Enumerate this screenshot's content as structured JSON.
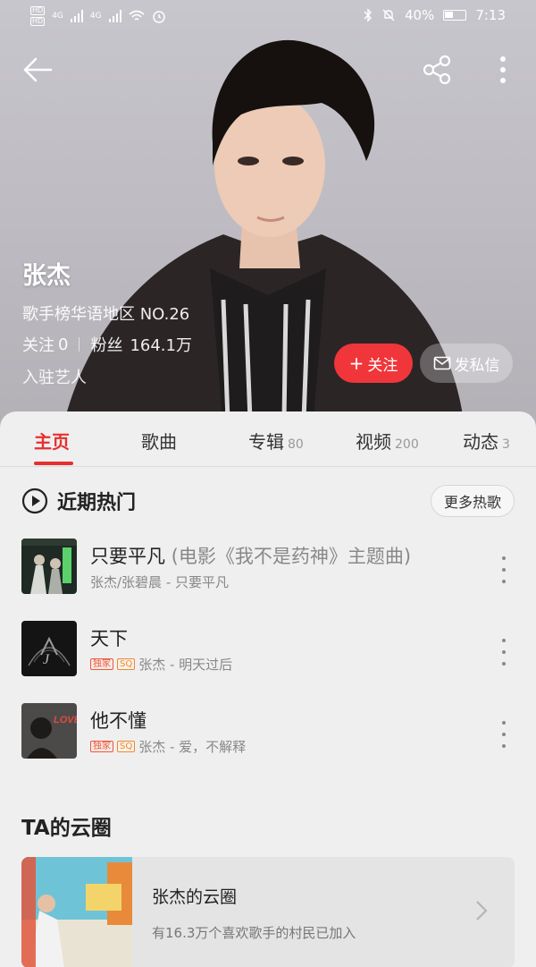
{
  "status_bar": {
    "hd1": "HD",
    "hd2": "HD",
    "net1": "4G",
    "net2": "4G",
    "battery": "40%",
    "time": "7:13"
  },
  "toolbar": {
    "back_icon": "back-arrow-icon",
    "share_icon": "share-icon",
    "more_icon": "more-vertical-icon"
  },
  "artist": {
    "name": "张杰",
    "rank": "歌手榜华语地区 NO.26",
    "following_label": "关注",
    "following_count": "0",
    "fans_label": "粉丝",
    "fans_count": "164.1万",
    "joined": "入驻艺人"
  },
  "actions": {
    "follow": "关注",
    "message": "发私信"
  },
  "tabs": [
    {
      "label": "主页",
      "count": ""
    },
    {
      "label": "歌曲",
      "count": ""
    },
    {
      "label": "专辑",
      "count": "80"
    },
    {
      "label": "视频",
      "count": "200"
    },
    {
      "label": "动态",
      "count": "3"
    }
  ],
  "hot_section": {
    "title": "近期热门",
    "more": "更多热歌"
  },
  "songs": [
    {
      "title": "只要平凡",
      "subtitle": " (电影《我不是药神》主题曲)",
      "exclusive": "",
      "sq": "",
      "meta": "张杰/张碧晨 - 只要平凡"
    },
    {
      "title": "天下",
      "subtitle": "",
      "exclusive": "独家",
      "sq": "SQ",
      "meta": "张杰 - 明天过后"
    },
    {
      "title": "他不懂",
      "subtitle": "",
      "exclusive": "独家",
      "sq": "SQ",
      "meta": "张杰 - 爱，不解释"
    }
  ],
  "cloud": {
    "section_title": "TA的云圈",
    "name": "张杰的云圈",
    "desc": "有16.3万个喜欢歌手的村民已加入"
  },
  "colors": {
    "accent": "#e6302e",
    "follow_button": "#f0363a"
  }
}
